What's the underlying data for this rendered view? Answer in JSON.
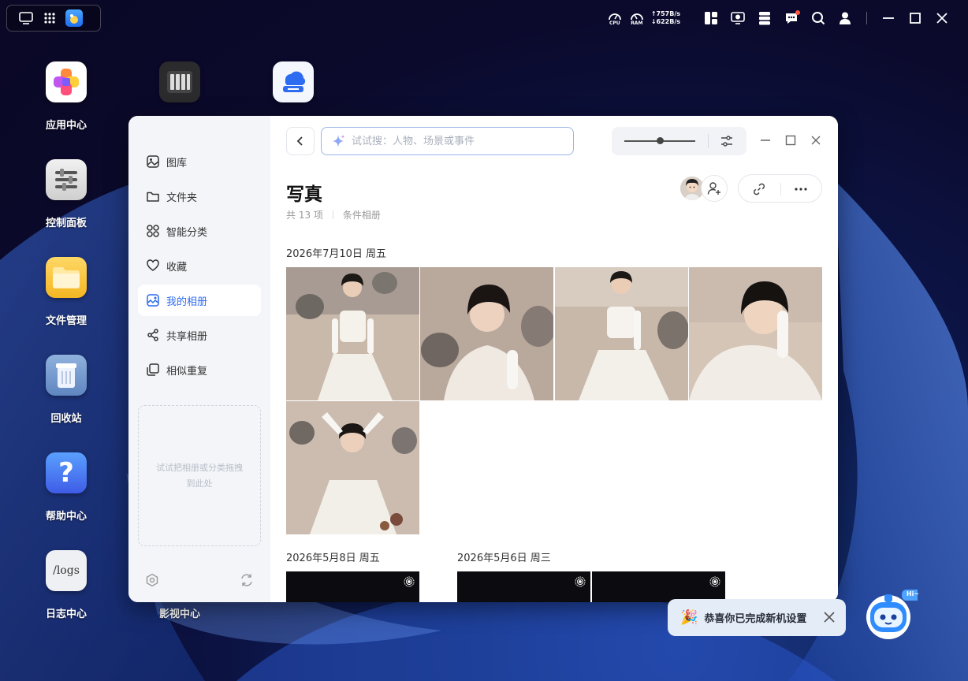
{
  "system_tray": {
    "cpu_label": "CPU",
    "ram_label": "RAM",
    "net_up": "↑757B/s",
    "net_down": "↓622B/s"
  },
  "desktop": {
    "icons": [
      {
        "label": "应用中心"
      },
      {
        "label": "控制面板"
      },
      {
        "label": "文件管理"
      },
      {
        "label": "回收站"
      },
      {
        "label": "帮助中心"
      },
      {
        "label": "日志中心",
        "icon_text": "/logs"
      },
      {
        "label": "影视中心"
      }
    ]
  },
  "window": {
    "sidebar": {
      "items": [
        {
          "label": "图库",
          "icon": "gallery-icon"
        },
        {
          "label": "文件夹",
          "icon": "folder-icon"
        },
        {
          "label": "智能分类",
          "icon": "smart-category-icon"
        },
        {
          "label": "收藏",
          "icon": "heart-icon"
        },
        {
          "label": "我的相册",
          "icon": "album-icon",
          "active": true
        },
        {
          "label": "共享相册",
          "icon": "share-icon"
        },
        {
          "label": "相似重复",
          "icon": "duplicate-icon"
        }
      ],
      "drop_hint": "试试把相册或分类拖拽到此处"
    },
    "search": {
      "placeholder": "试试搜：人物、场景或事件"
    },
    "view": {
      "zoom_level": 0.5
    },
    "album": {
      "title": "写真",
      "count": "共 13 项",
      "type": "条件相册"
    },
    "groups": [
      {
        "date": "2026年7月10日 周五"
      },
      {
        "date": "2026年5月8日 周五"
      },
      {
        "date": "2026年5月6日 周三"
      }
    ]
  },
  "notification": {
    "text": "恭喜你已完成新机设置",
    "emoji": "🎉"
  },
  "assistant": {
    "badge": "Hi~"
  },
  "colors": {
    "accent": "#2d6cf0",
    "sidebar_bg": "#f3f5f8"
  }
}
